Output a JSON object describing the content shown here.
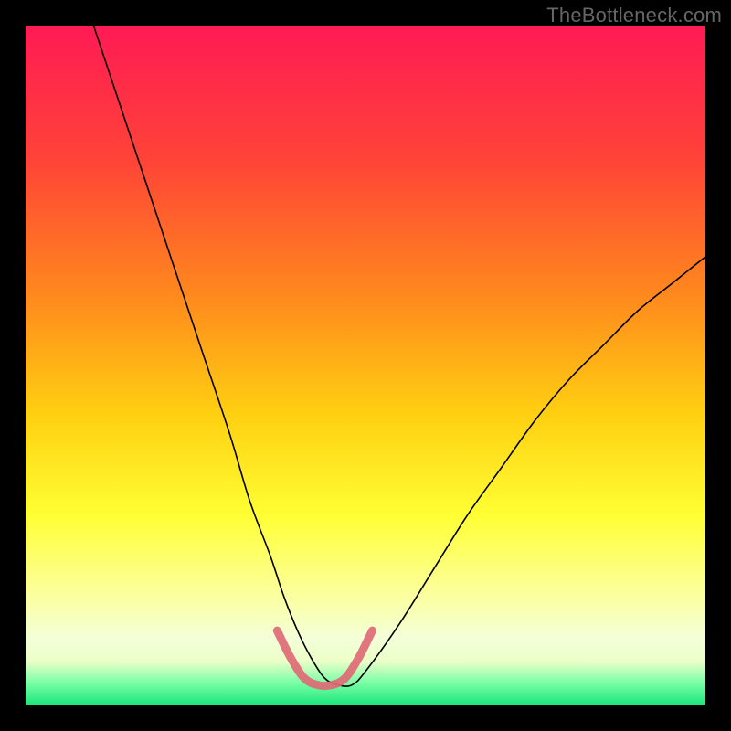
{
  "watermark": "TheBottleneck.com",
  "chart_data": {
    "type": "line",
    "title": "",
    "xlabel": "",
    "ylabel": "",
    "xlim": [
      0,
      100
    ],
    "ylim": [
      0,
      100
    ],
    "grid": false,
    "legend": false,
    "background": {
      "type": "vertical_gradient",
      "stops": [
        {
          "pos": 0.0,
          "color": "#ff1a55"
        },
        {
          "pos": 0.2,
          "color": "#ff4437"
        },
        {
          "pos": 0.4,
          "color": "#ff8a1d"
        },
        {
          "pos": 0.57,
          "color": "#ffcf11"
        },
        {
          "pos": 0.72,
          "color": "#ffff33"
        },
        {
          "pos": 0.84,
          "color": "#fbffa0"
        },
        {
          "pos": 0.9,
          "color": "#f4ffd8"
        },
        {
          "pos": 0.935,
          "color": "#ecffc9"
        },
        {
          "pos": 0.965,
          "color": "#7fffa8"
        },
        {
          "pos": 1.0,
          "color": "#18e67a"
        }
      ]
    },
    "series": [
      {
        "name": "bottleneck-curve",
        "stroke": "#000000",
        "stroke_width": 1.6,
        "x": [
          10,
          14,
          18,
          22,
          26,
          30,
          33,
          36,
          38,
          40,
          42,
          44,
          46,
          48,
          50,
          55,
          60,
          65,
          70,
          75,
          80,
          85,
          90,
          95,
          100
        ],
        "y": [
          100,
          88,
          76,
          64,
          52,
          40,
          30,
          22,
          16,
          11,
          7,
          4,
          3,
          3,
          5,
          12,
          20,
          28,
          35,
          42,
          48,
          53,
          58,
          62,
          66
        ]
      },
      {
        "name": "optimal-range-highlight",
        "stroke": "#e06a76",
        "stroke_width": 9,
        "x": [
          37,
          39,
          41,
          43,
          45,
          47,
          49,
          51
        ],
        "y": [
          11,
          7,
          4,
          3,
          3,
          4,
          7,
          11
        ]
      }
    ]
  }
}
